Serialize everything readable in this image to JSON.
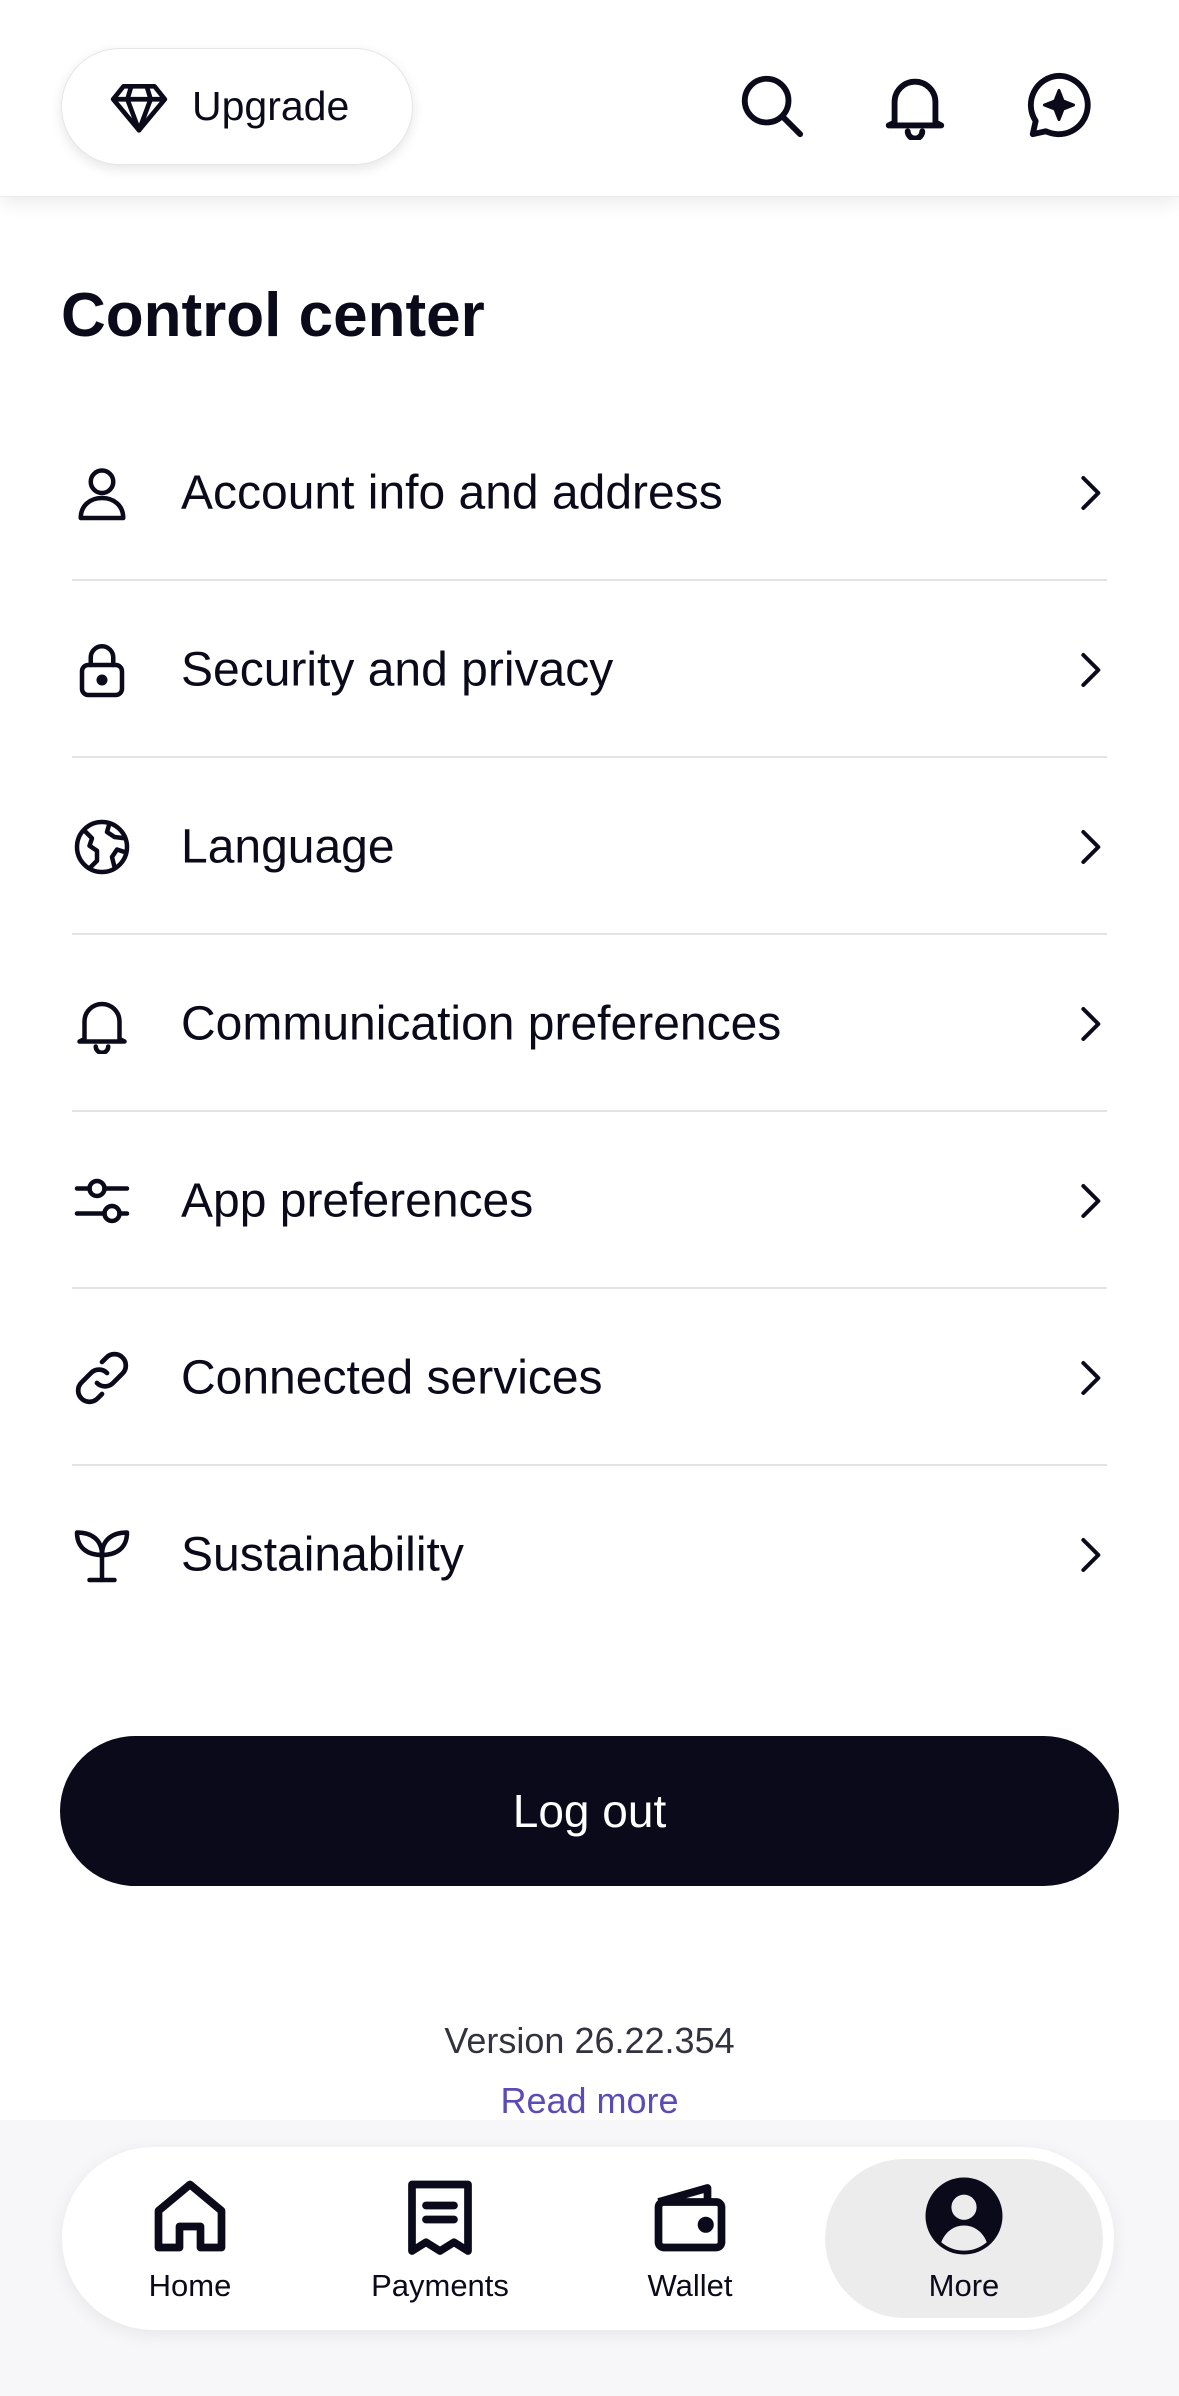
{
  "header": {
    "upgrade_label": "Upgrade",
    "icons": [
      "diamond-icon",
      "search-icon",
      "bell-icon",
      "assistant-icon"
    ]
  },
  "title": "Control center",
  "menu": {
    "items": [
      {
        "label": "Account info and address",
        "icon": "user-icon"
      },
      {
        "label": "Security and privacy",
        "icon": "lock-icon"
      },
      {
        "label": "Language",
        "icon": "globe-icon"
      },
      {
        "label": "Communication preferences",
        "icon": "bell-icon"
      },
      {
        "label": "App preferences",
        "icon": "sliders-icon"
      },
      {
        "label": "Connected services",
        "icon": "link-icon"
      },
      {
        "label": "Sustainability",
        "icon": "sprout-icon"
      }
    ]
  },
  "logout_label": "Log out",
  "version_text": "Version 26.22.354",
  "read_more_label": "Read more",
  "nav": {
    "items": [
      {
        "label": "Home",
        "icon": "home-icon",
        "active": false
      },
      {
        "label": "Payments",
        "icon": "receipt-icon",
        "active": false
      },
      {
        "label": "Wallet",
        "icon": "wallet-icon",
        "active": false
      },
      {
        "label": "More",
        "icon": "profile-icon",
        "active": true
      }
    ]
  },
  "colors": {
    "text": "#0b0a1a",
    "button_dark": "#0b0a1a",
    "link": "#5b4bb5",
    "divider": "#e3e3e3",
    "active_nav_bg": "#ececec"
  }
}
